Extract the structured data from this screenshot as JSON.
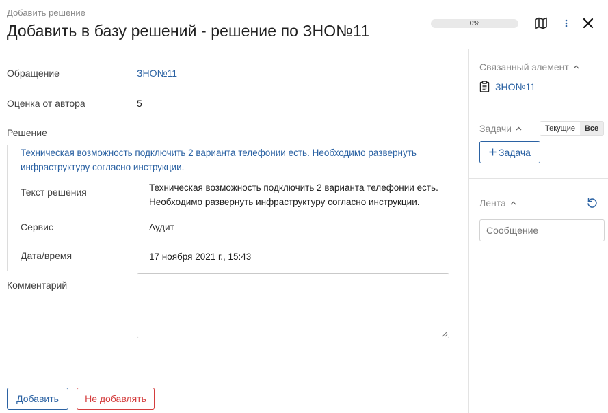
{
  "header": {
    "breadcrumb": "Добавить решение",
    "title": "Добавить в базу решений - решение по ЗНО№11",
    "progress_text": "0%",
    "progress_value": 0
  },
  "form": {
    "request_label": "Обращение",
    "request_value": "ЗНО№11",
    "rating_label": "Оценка от автора",
    "rating_value": "5",
    "solution_label": "Решение",
    "solution_summary": "Техническая возможность подключить 2 варианта телефонии есть. Необходимо развернуть инфраструктуру согласно инструкции.",
    "solution_text_label": "Текст решения",
    "solution_text_value": "Техническая возможность подключить 2 варианта телефонии есть. Необходимо развернуть инфраструктуру согласно инструкции.",
    "service_label": "Сервис",
    "service_value": "Аудит",
    "datetime_label": "Дата/время",
    "datetime_value": "17 ноября 2021 г., 15:43",
    "comment_label": "Комментарий",
    "comment_value": ""
  },
  "footer": {
    "add_label": "Добавить",
    "skip_label": "Не добавлять"
  },
  "sidebar": {
    "related_title": "Связанный элемент",
    "related_link": "ЗНО№11",
    "tasks_title": "Задачи",
    "tasks_filters": [
      "Текущие",
      "Все"
    ],
    "tasks_active_filter": "Все",
    "add_task_label": "Задача",
    "feed_title": "Лента",
    "message_placeholder": "Сообщение"
  },
  "colors": {
    "accent": "#2b62a3",
    "danger": "#d43d3d"
  },
  "icons": [
    "map-icon",
    "more-vertical-icon",
    "close-icon",
    "chevron-up-icon",
    "clipboard-icon",
    "plus-icon",
    "refresh-icon"
  ]
}
